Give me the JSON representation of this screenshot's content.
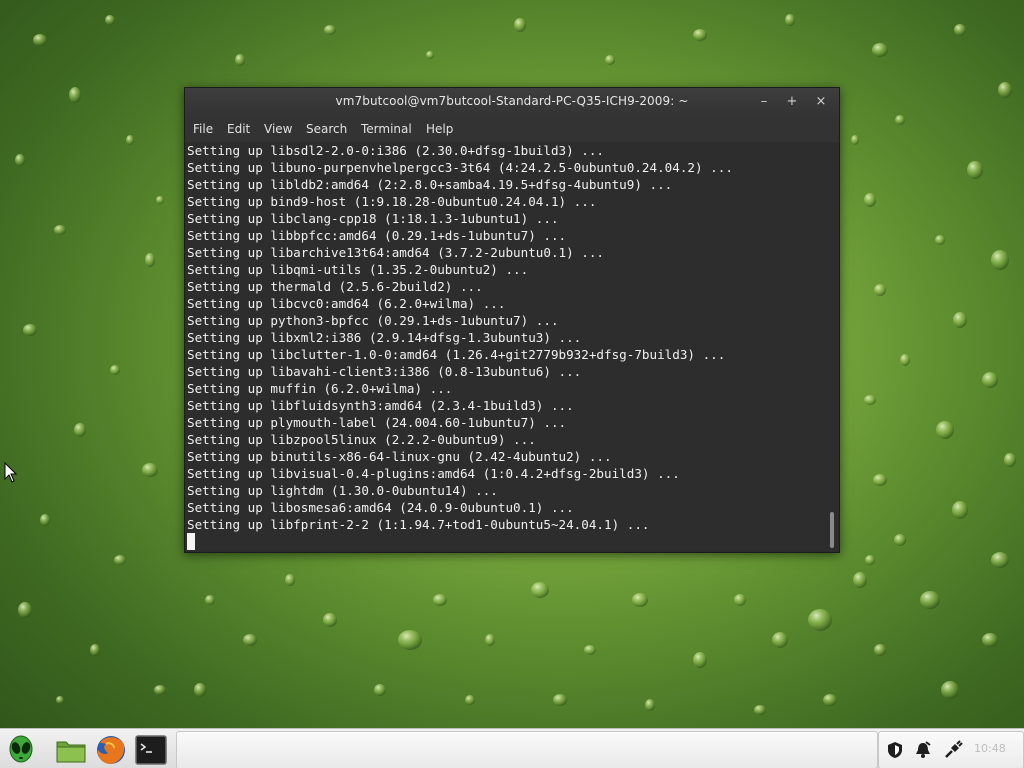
{
  "window": {
    "title": "vm7butcool@vm7butcool-Standard-PC-Q35-ICH9-2009: ~",
    "controls": {
      "minimize": "–",
      "maximize": "+",
      "close": "×"
    }
  },
  "menubar": {
    "items": [
      "File",
      "Edit",
      "View",
      "Search",
      "Terminal",
      "Help"
    ]
  },
  "terminal": {
    "lines": [
      "Setting up libsdl2-2.0-0:i386 (2.30.0+dfsg-1build3) ...",
      "Setting up libuno-purpenvhelpergcc3-3t64 (4:24.2.5-0ubuntu0.24.04.2) ...",
      "Setting up libldb2:amd64 (2:2.8.0+samba4.19.5+dfsg-4ubuntu9) ...",
      "Setting up bind9-host (1:9.18.28-0ubuntu0.24.04.1) ...",
      "Setting up libclang-cpp18 (1:18.1.3-1ubuntu1) ...",
      "Setting up libbpfcc:amd64 (0.29.1+ds-1ubuntu7) ...",
      "Setting up libarchive13t64:amd64 (3.7.2-2ubuntu0.1) ...",
      "Setting up libqmi-utils (1.35.2-0ubuntu2) ...",
      "Setting up thermald (2.5.6-2build2) ...",
      "Setting up libcvc0:amd64 (6.2.0+wilma) ...",
      "Setting up python3-bpfcc (0.29.1+ds-1ubuntu7) ...",
      "Setting up libxml2:i386 (2.9.14+dfsg-1.3ubuntu3) ...",
      "Setting up libclutter-1.0-0:amd64 (1.26.4+git2779b932+dfsg-7build3) ...",
      "Setting up libavahi-client3:i386 (0.8-13ubuntu6) ...",
      "Setting up muffin (6.2.0+wilma) ...",
      "Setting up libfluidsynth3:amd64 (2.3.4-1build3) ...",
      "Setting up plymouth-label (24.004.60-1ubuntu7) ...",
      "Setting up libzpool5linux (2.2.2-0ubuntu9) ...",
      "Setting up binutils-x86-64-linux-gnu (2.42-4ubuntu2) ...",
      "Setting up libvisual-0.4-plugins:amd64 (1:0.4.2+dfsg-2build3) ...",
      "Setting up lightdm (1.30.0-0ubuntu14) ...",
      "Setting up libosmesa6:amd64 (24.0.9-0ubuntu0.1) ...",
      "Setting up libfprint-2-2 (1:1.94.7+tod1-0ubuntu5~24.04.1) ..."
    ]
  },
  "taskbar": {
    "launchers": [
      "alien-icon",
      "folder-icon",
      "firefox-icon",
      "terminal-icon"
    ],
    "tray_icons": [
      "shield-icon",
      "bell-icon",
      "network-icon"
    ],
    "clock": "10:48"
  },
  "colors": {
    "terminal_bg": "#2d2d2d",
    "terminal_fg": "#f0f0f0",
    "titlebar_bg": "#383838",
    "desktop_green": "#6b9b35"
  }
}
